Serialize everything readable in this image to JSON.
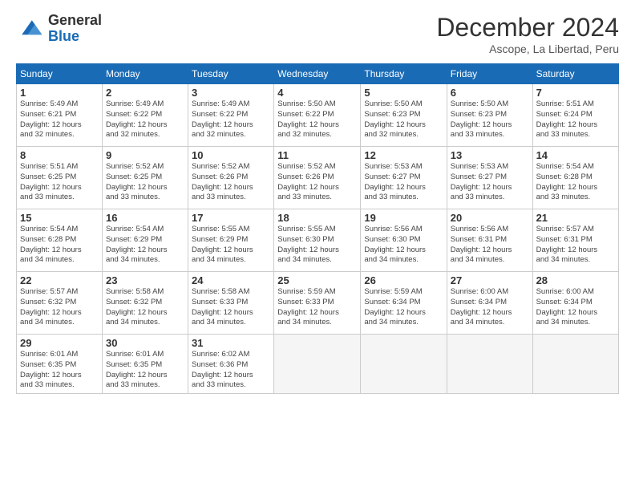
{
  "logo": {
    "general": "General",
    "blue": "Blue"
  },
  "header": {
    "month_title": "December 2024",
    "subtitle": "Ascope, La Libertad, Peru"
  },
  "weekdays": [
    "Sunday",
    "Monday",
    "Tuesday",
    "Wednesday",
    "Thursday",
    "Friday",
    "Saturday"
  ],
  "weeks": [
    [
      {
        "day": 1,
        "content": "Sunrise: 5:49 AM\nSunset: 6:21 PM\nDaylight: 12 hours\nand 32 minutes."
      },
      {
        "day": 2,
        "content": "Sunrise: 5:49 AM\nSunset: 6:22 PM\nDaylight: 12 hours\nand 32 minutes."
      },
      {
        "day": 3,
        "content": "Sunrise: 5:49 AM\nSunset: 6:22 PM\nDaylight: 12 hours\nand 32 minutes."
      },
      {
        "day": 4,
        "content": "Sunrise: 5:50 AM\nSunset: 6:22 PM\nDaylight: 12 hours\nand 32 minutes."
      },
      {
        "day": 5,
        "content": "Sunrise: 5:50 AM\nSunset: 6:23 PM\nDaylight: 12 hours\nand 32 minutes."
      },
      {
        "day": 6,
        "content": "Sunrise: 5:50 AM\nSunset: 6:23 PM\nDaylight: 12 hours\nand 33 minutes."
      },
      {
        "day": 7,
        "content": "Sunrise: 5:51 AM\nSunset: 6:24 PM\nDaylight: 12 hours\nand 33 minutes."
      }
    ],
    [
      {
        "day": 8,
        "content": "Sunrise: 5:51 AM\nSunset: 6:25 PM\nDaylight: 12 hours\nand 33 minutes."
      },
      {
        "day": 9,
        "content": "Sunrise: 5:52 AM\nSunset: 6:25 PM\nDaylight: 12 hours\nand 33 minutes."
      },
      {
        "day": 10,
        "content": "Sunrise: 5:52 AM\nSunset: 6:26 PM\nDaylight: 12 hours\nand 33 minutes."
      },
      {
        "day": 11,
        "content": "Sunrise: 5:52 AM\nSunset: 6:26 PM\nDaylight: 12 hours\nand 33 minutes."
      },
      {
        "day": 12,
        "content": "Sunrise: 5:53 AM\nSunset: 6:27 PM\nDaylight: 12 hours\nand 33 minutes."
      },
      {
        "day": 13,
        "content": "Sunrise: 5:53 AM\nSunset: 6:27 PM\nDaylight: 12 hours\nand 33 minutes."
      },
      {
        "day": 14,
        "content": "Sunrise: 5:54 AM\nSunset: 6:28 PM\nDaylight: 12 hours\nand 33 minutes."
      }
    ],
    [
      {
        "day": 15,
        "content": "Sunrise: 5:54 AM\nSunset: 6:28 PM\nDaylight: 12 hours\nand 34 minutes."
      },
      {
        "day": 16,
        "content": "Sunrise: 5:54 AM\nSunset: 6:29 PM\nDaylight: 12 hours\nand 34 minutes."
      },
      {
        "day": 17,
        "content": "Sunrise: 5:55 AM\nSunset: 6:29 PM\nDaylight: 12 hours\nand 34 minutes."
      },
      {
        "day": 18,
        "content": "Sunrise: 5:55 AM\nSunset: 6:30 PM\nDaylight: 12 hours\nand 34 minutes."
      },
      {
        "day": 19,
        "content": "Sunrise: 5:56 AM\nSunset: 6:30 PM\nDaylight: 12 hours\nand 34 minutes."
      },
      {
        "day": 20,
        "content": "Sunrise: 5:56 AM\nSunset: 6:31 PM\nDaylight: 12 hours\nand 34 minutes."
      },
      {
        "day": 21,
        "content": "Sunrise: 5:57 AM\nSunset: 6:31 PM\nDaylight: 12 hours\nand 34 minutes."
      }
    ],
    [
      {
        "day": 22,
        "content": "Sunrise: 5:57 AM\nSunset: 6:32 PM\nDaylight: 12 hours\nand 34 minutes."
      },
      {
        "day": 23,
        "content": "Sunrise: 5:58 AM\nSunset: 6:32 PM\nDaylight: 12 hours\nand 34 minutes."
      },
      {
        "day": 24,
        "content": "Sunrise: 5:58 AM\nSunset: 6:33 PM\nDaylight: 12 hours\nand 34 minutes."
      },
      {
        "day": 25,
        "content": "Sunrise: 5:59 AM\nSunset: 6:33 PM\nDaylight: 12 hours\nand 34 minutes."
      },
      {
        "day": 26,
        "content": "Sunrise: 5:59 AM\nSunset: 6:34 PM\nDaylight: 12 hours\nand 34 minutes."
      },
      {
        "day": 27,
        "content": "Sunrise: 6:00 AM\nSunset: 6:34 PM\nDaylight: 12 hours\nand 34 minutes."
      },
      {
        "day": 28,
        "content": "Sunrise: 6:00 AM\nSunset: 6:34 PM\nDaylight: 12 hours\nand 34 minutes."
      }
    ],
    [
      {
        "day": 29,
        "content": "Sunrise: 6:01 AM\nSunset: 6:35 PM\nDaylight: 12 hours\nand 33 minutes."
      },
      {
        "day": 30,
        "content": "Sunrise: 6:01 AM\nSunset: 6:35 PM\nDaylight: 12 hours\nand 33 minutes."
      },
      {
        "day": 31,
        "content": "Sunrise: 6:02 AM\nSunset: 6:36 PM\nDaylight: 12 hours\nand 33 minutes."
      },
      null,
      null,
      null,
      null
    ]
  ]
}
